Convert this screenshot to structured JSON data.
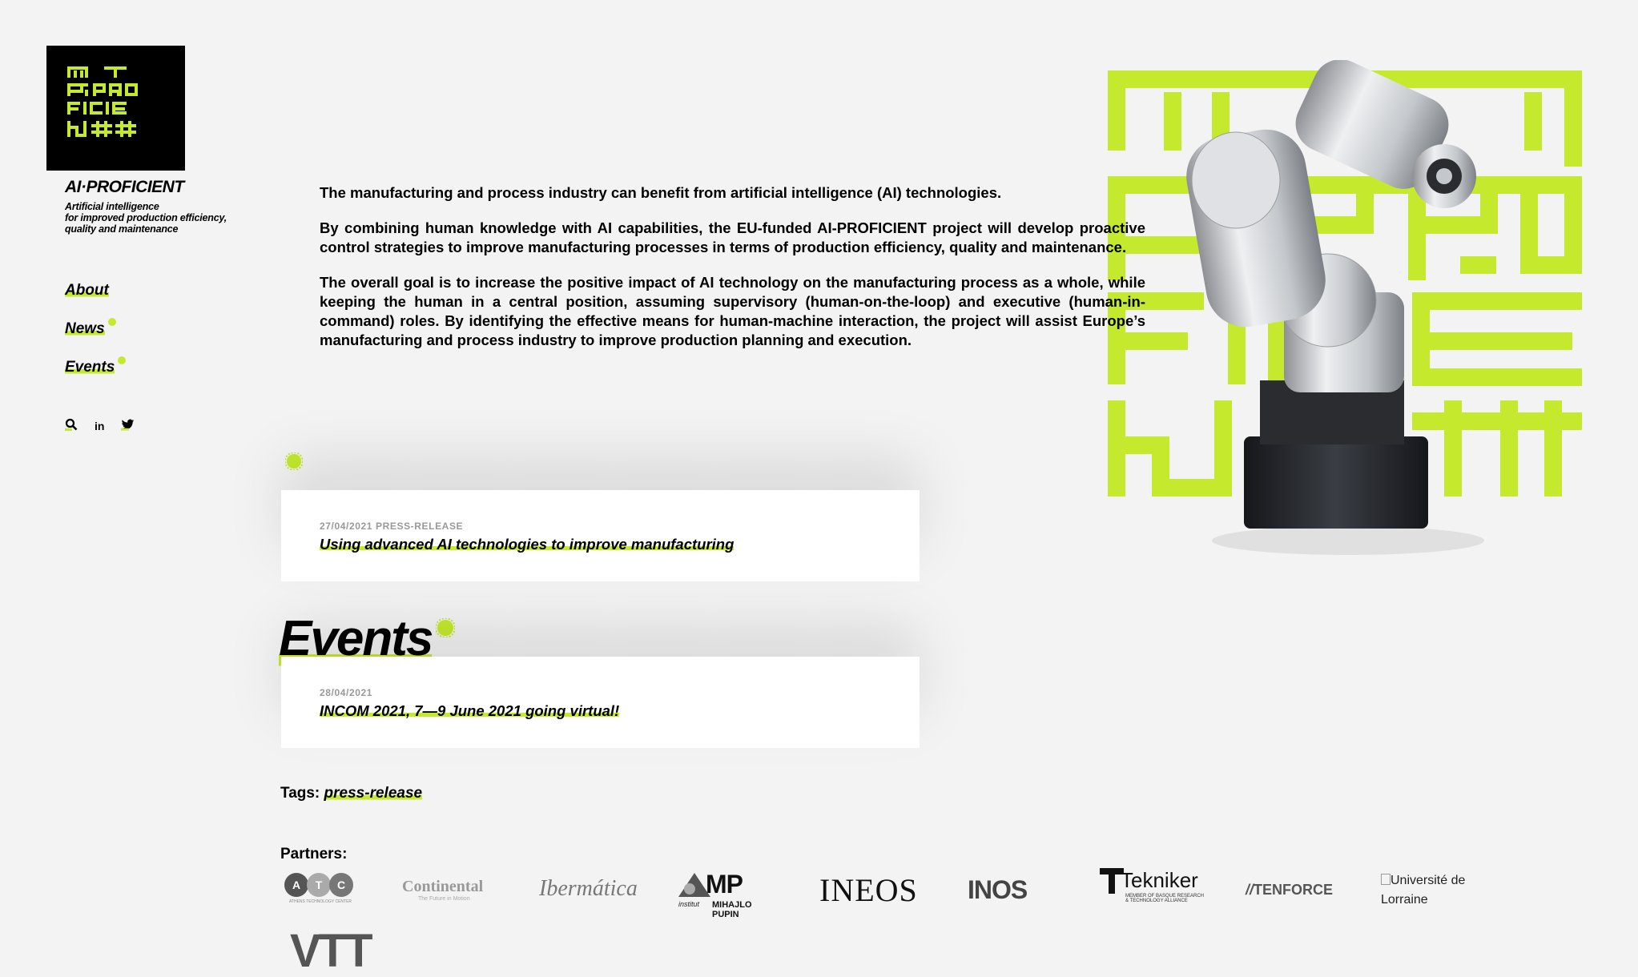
{
  "brand": {
    "name": "AI·PROFICIENT",
    "tagline": [
      "Artificial intelligence",
      "for improved production efficiency,",
      "quality and maintenance"
    ],
    "accent": "#c5ea2d"
  },
  "nav": {
    "items": [
      {
        "label": "About"
      },
      {
        "label": "News"
      },
      {
        "label": "Events"
      }
    ]
  },
  "social": [
    "search-icon",
    "linkedin-icon",
    "twitter-icon"
  ],
  "social_labels": {
    "linkedin": "in"
  },
  "intro": {
    "paragraphs": [
      "The manufacturing and process industry can benefit from artificial intelligence (AI) technologies.",
      "By combining human knowledge with AI capabilities, the EU-funded AI-PROFICIENT project will develop proactive control strategies to improve manufacturing processes in terms of production efficiency, quality and maintenance.",
      "The overall goal is to increase the positive impact of AI technology on the manufacturing process as a whole, while keeping the human in a central position, assuming supervisory (human-on-the-loop) and executive (human-in-command) roles. By identifying the effective means for human-machine interaction, the project will assist Europe’s manufacturing and process industry to improve production planning and execution."
    ]
  },
  "news": {
    "meta": "27/04/2021 PRESS-RELEASE",
    "title": "Using advanced AI technologies to improve manufacturing"
  },
  "events": {
    "heading": "Events",
    "meta": "28/04/2021",
    "title": "INCOM 2021, 7—9 June 2021 going virtual!"
  },
  "tags": {
    "label": "Tags:",
    "items": [
      "press-release"
    ]
  },
  "partners": {
    "label": "Partners:",
    "atc_letters": [
      "A",
      "T",
      "C"
    ],
    "atc_sub": "ATHENS TECHNOLOGY CENTER",
    "continental": "Continental",
    "continental_sub": "The Future in Motion",
    "ibermatica": "Ibermática",
    "pupin_mp": "MP",
    "pupin_institut": "institut",
    "pupin_name": "MIHAJLO PUPIN",
    "ineos": "INEOS",
    "inos": "INOS",
    "tekniker": "Tekniker",
    "tekniker_sub_1": "MEMBER OF BASQUE RESEARCH",
    "tekniker_sub_2": "& TECHNOLOGY ALLIANCE",
    "tenforce": "TENFORCE",
    "lorraine": "Université de Lorraine",
    "vtt": "VTT"
  }
}
